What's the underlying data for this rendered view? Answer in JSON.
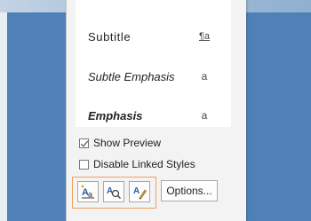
{
  "styles_list": {
    "items": [
      {
        "name": "Subtitle",
        "symbol": "¶a"
      },
      {
        "name": "Subtle Emphasis",
        "symbol": "a"
      },
      {
        "name": "Emphasis",
        "symbol": "a"
      }
    ]
  },
  "options": {
    "show_preview": {
      "label": "Show Preview",
      "checked": true
    },
    "disable_linked_styles": {
      "label": "Disable Linked Styles",
      "checked": false
    }
  },
  "buttons": {
    "new_style_icon": "new-style-icon",
    "style_inspector_icon": "style-inspector-icon",
    "manage_styles_icon": "manage-styles-icon",
    "options_label": "Options..."
  },
  "colors": {
    "highlight_border": "#f0a05a",
    "pane_bg": "#f3f3f3"
  }
}
